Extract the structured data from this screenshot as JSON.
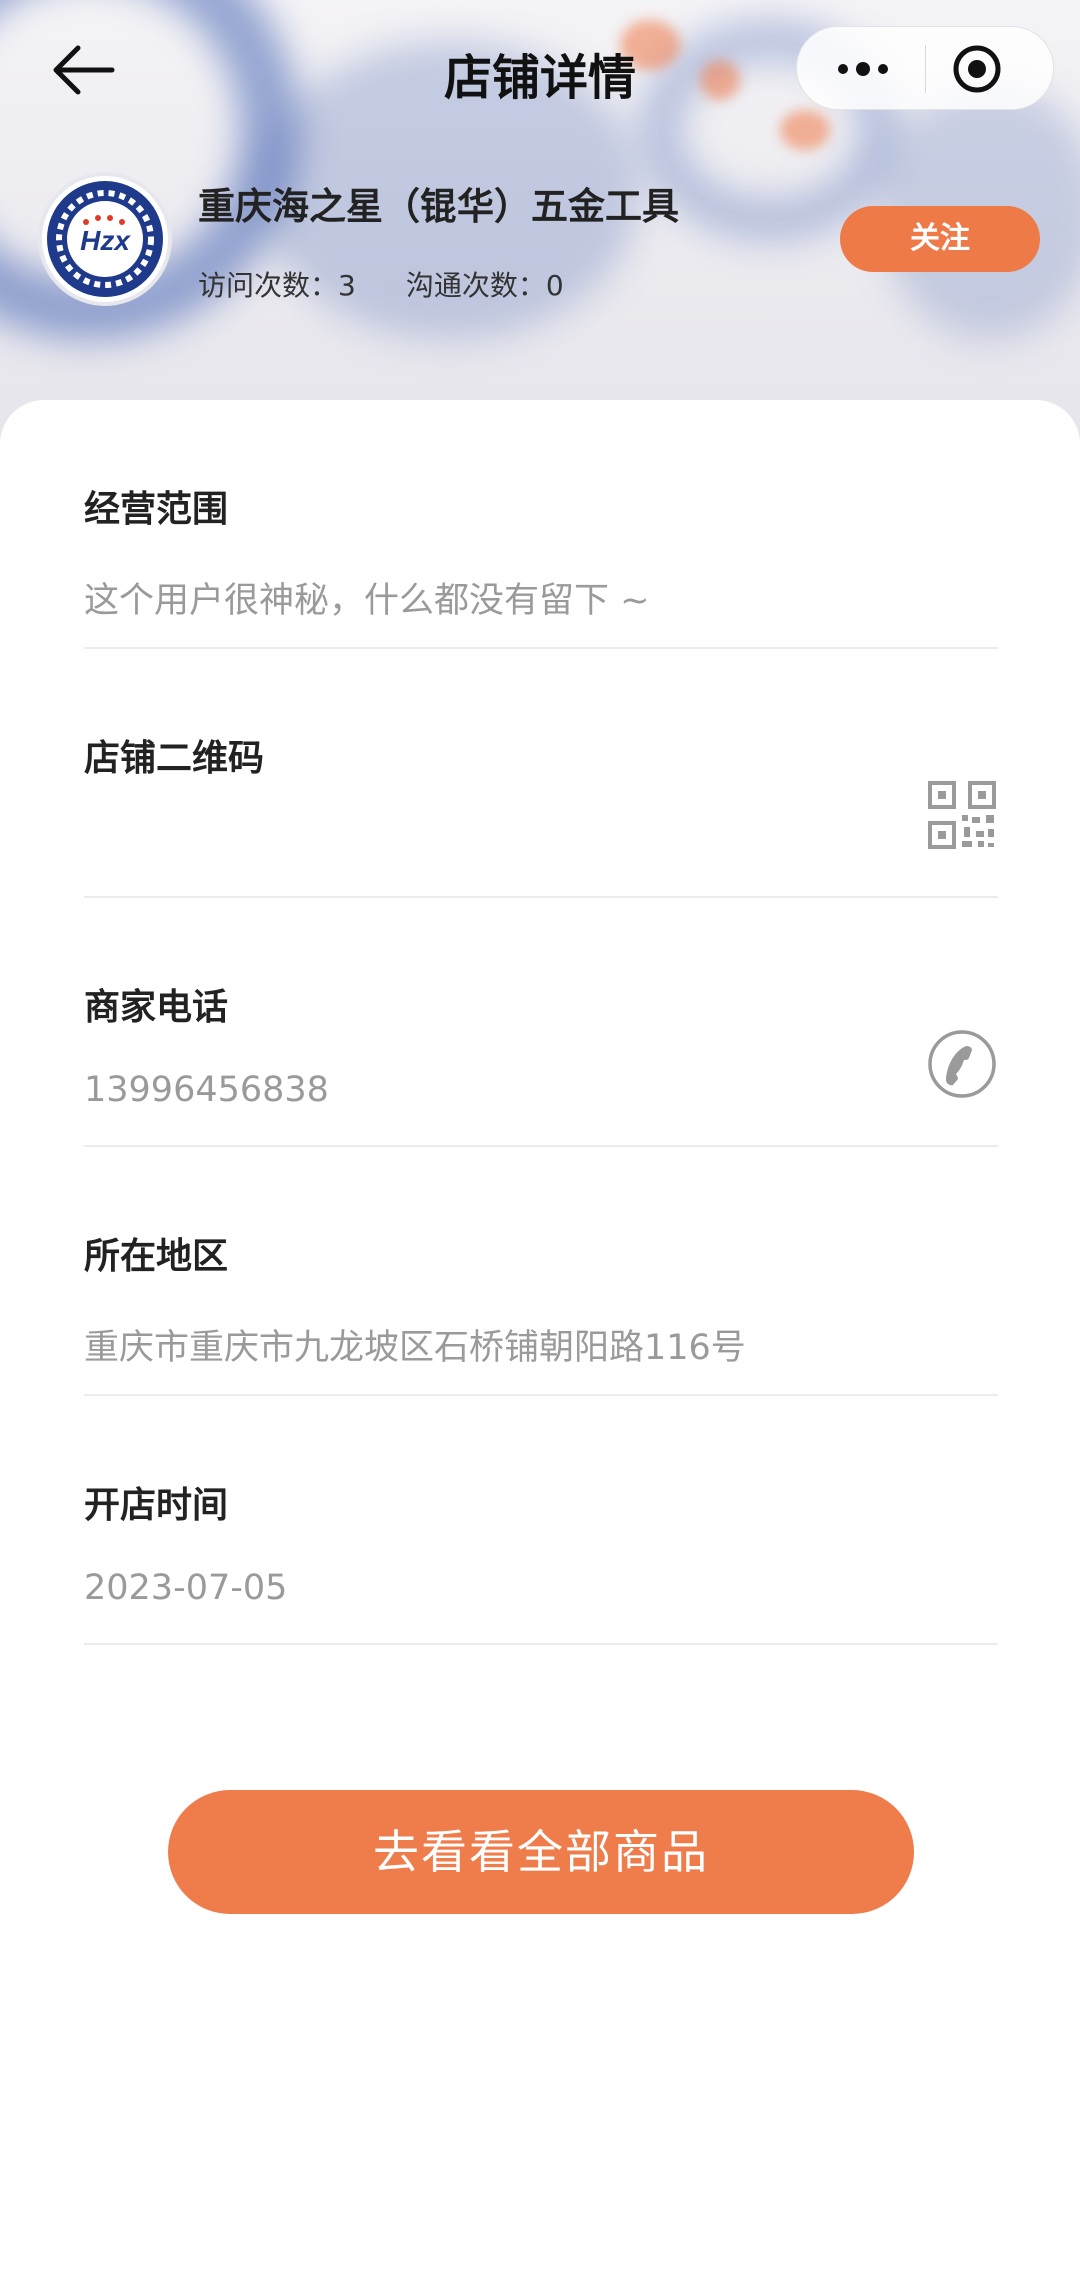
{
  "nav": {
    "title": "店铺详情",
    "back_icon": "back-arrow-icon",
    "more_icon": "more-dots-icon",
    "close_icon": "target-circle-icon"
  },
  "shop": {
    "logo_text": "Hzx",
    "name": "重庆海之星（锟华）五金工具",
    "visit_label": "访问次数：",
    "visit_count": "3",
    "contact_label": "沟通次数：",
    "contact_count": "0",
    "follow_label": "关注"
  },
  "sections": [
    {
      "title": "经营范围",
      "value": "这个用户很神秘，什么都没有留下 ~"
    },
    {
      "title": "店铺二维码",
      "value": "",
      "icon": "qr-code-icon"
    },
    {
      "title": "商家电话",
      "value": "13996456838",
      "icon": "phone-icon"
    },
    {
      "title": "所在地区",
      "value": "重庆市重庆市九龙坡区石桥铺朝阳路116号"
    },
    {
      "title": "开店时间",
      "value": "2023-07-05"
    }
  ],
  "cta": {
    "label": "去看看全部商品"
  },
  "colors": {
    "accent": "#EF7D4C",
    "logo_blue": "#1F3A8A",
    "muted_text": "#9A9A9A"
  }
}
